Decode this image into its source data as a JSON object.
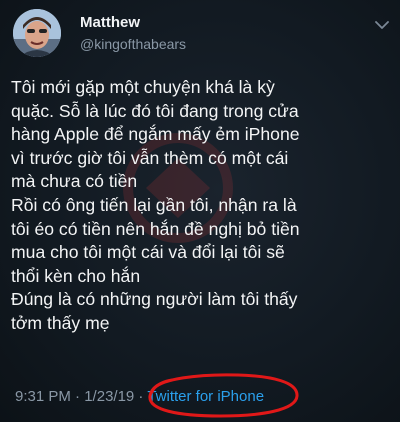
{
  "user": {
    "display_name": "Matthew",
    "handle": "@kingofthabears",
    "avatar_icon": "profile-avatar"
  },
  "tweet": {
    "lines": [
      "Tôi mới gặp một chuyện khá là kỳ",
      "quặc. Sỗ là lúc đó tôi đang trong cửa",
      "hàng Apple để ngắm mấy ẻm iPhone",
      "vì trước giờ tôi vẫn thèm có một cái",
      "mà chưa có tiền",
      "Rồi có ông tiến lại gần tôi, nhận ra là",
      "tôi éo có tiền nên hắn đề nghị bỏ tiền",
      "mua cho tôi một cái và đổi lại tôi sẽ",
      "thổi kèn cho hắn",
      "Đúng là có những người làm tôi thấy",
      "tởm thấy mẹ"
    ]
  },
  "meta": {
    "time": "9:31 PM",
    "separator_1": " · ",
    "date": "1/23/19",
    "separator_2": " · ",
    "source": "Twitter for iPhone"
  },
  "colors": {
    "background": "#10171e",
    "text": "#f3f4f5",
    "muted": "#8a98a6",
    "link": "#2aa0ec",
    "annotation_circle": "#e01818"
  }
}
